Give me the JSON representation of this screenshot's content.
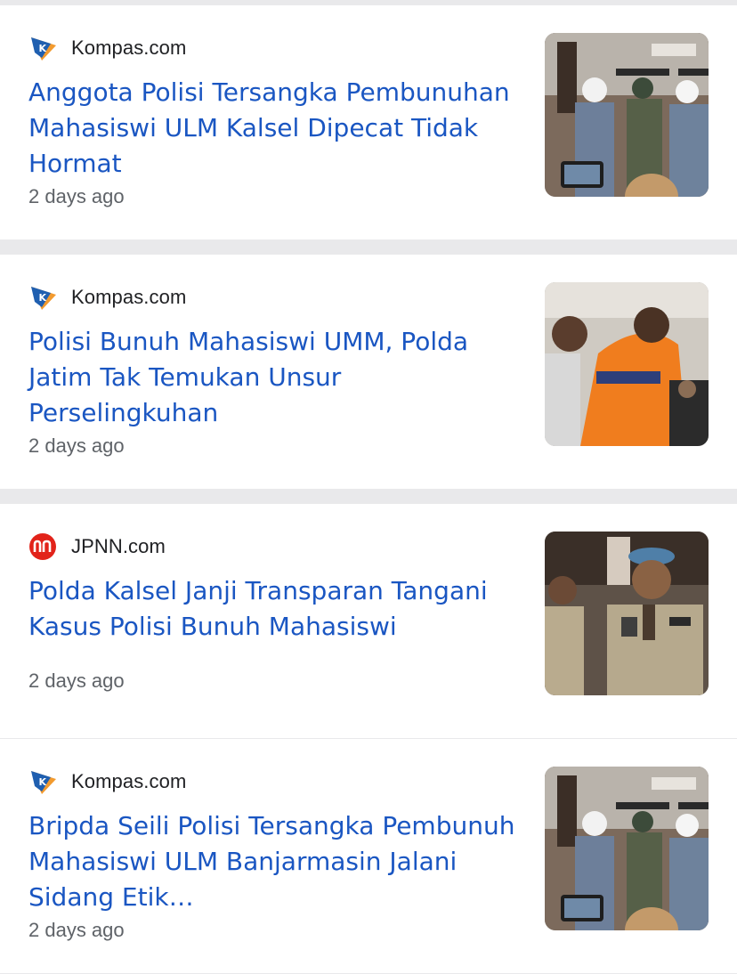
{
  "articles": [
    {
      "source": "Kompas.com",
      "source_icon": "kompas-logo-icon",
      "title": "Anggota Polisi Tersangka Pembunuhan Mahasiswi ULM Kalsel Dipecat Tidak Hormat",
      "time": "2 days ago",
      "thumbnail": "police-ceremony-photo"
    },
    {
      "source": "Kompas.com",
      "source_icon": "kompas-logo-icon",
      "title": "Polisi Bunuh Mahasiswi UMM, Polda Jatim Tak Temukan Unsur Perselingkuhan",
      "time": "2 days ago",
      "thumbnail": "suspect-orange-shirt-photo"
    },
    {
      "source": "JPNN.com",
      "source_icon": "jpnn-logo-icon",
      "title": "Polda Kalsel Janji Transparan Tangani Kasus Polisi Bunuh Mahasiswi",
      "time": "2 days ago",
      "thumbnail": "police-officer-press-photo"
    },
    {
      "source": "Kompas.com",
      "source_icon": "kompas-logo-icon",
      "title": "Bripda Seili Polisi Tersangka Pembunuh Mahasiswi ULM Banjarmasin Jalani Sidang Etik…",
      "time": "2 days ago",
      "thumbnail": "police-ceremony-photo"
    }
  ],
  "colors": {
    "headline": "#1a56c2",
    "source_text": "#202124",
    "time_text": "#5f6368",
    "divider": "#e9e9eb",
    "kompas_blue": "#1f5fb0",
    "kompas_orange": "#f29a2e",
    "jpnn_red": "#e2231a"
  }
}
